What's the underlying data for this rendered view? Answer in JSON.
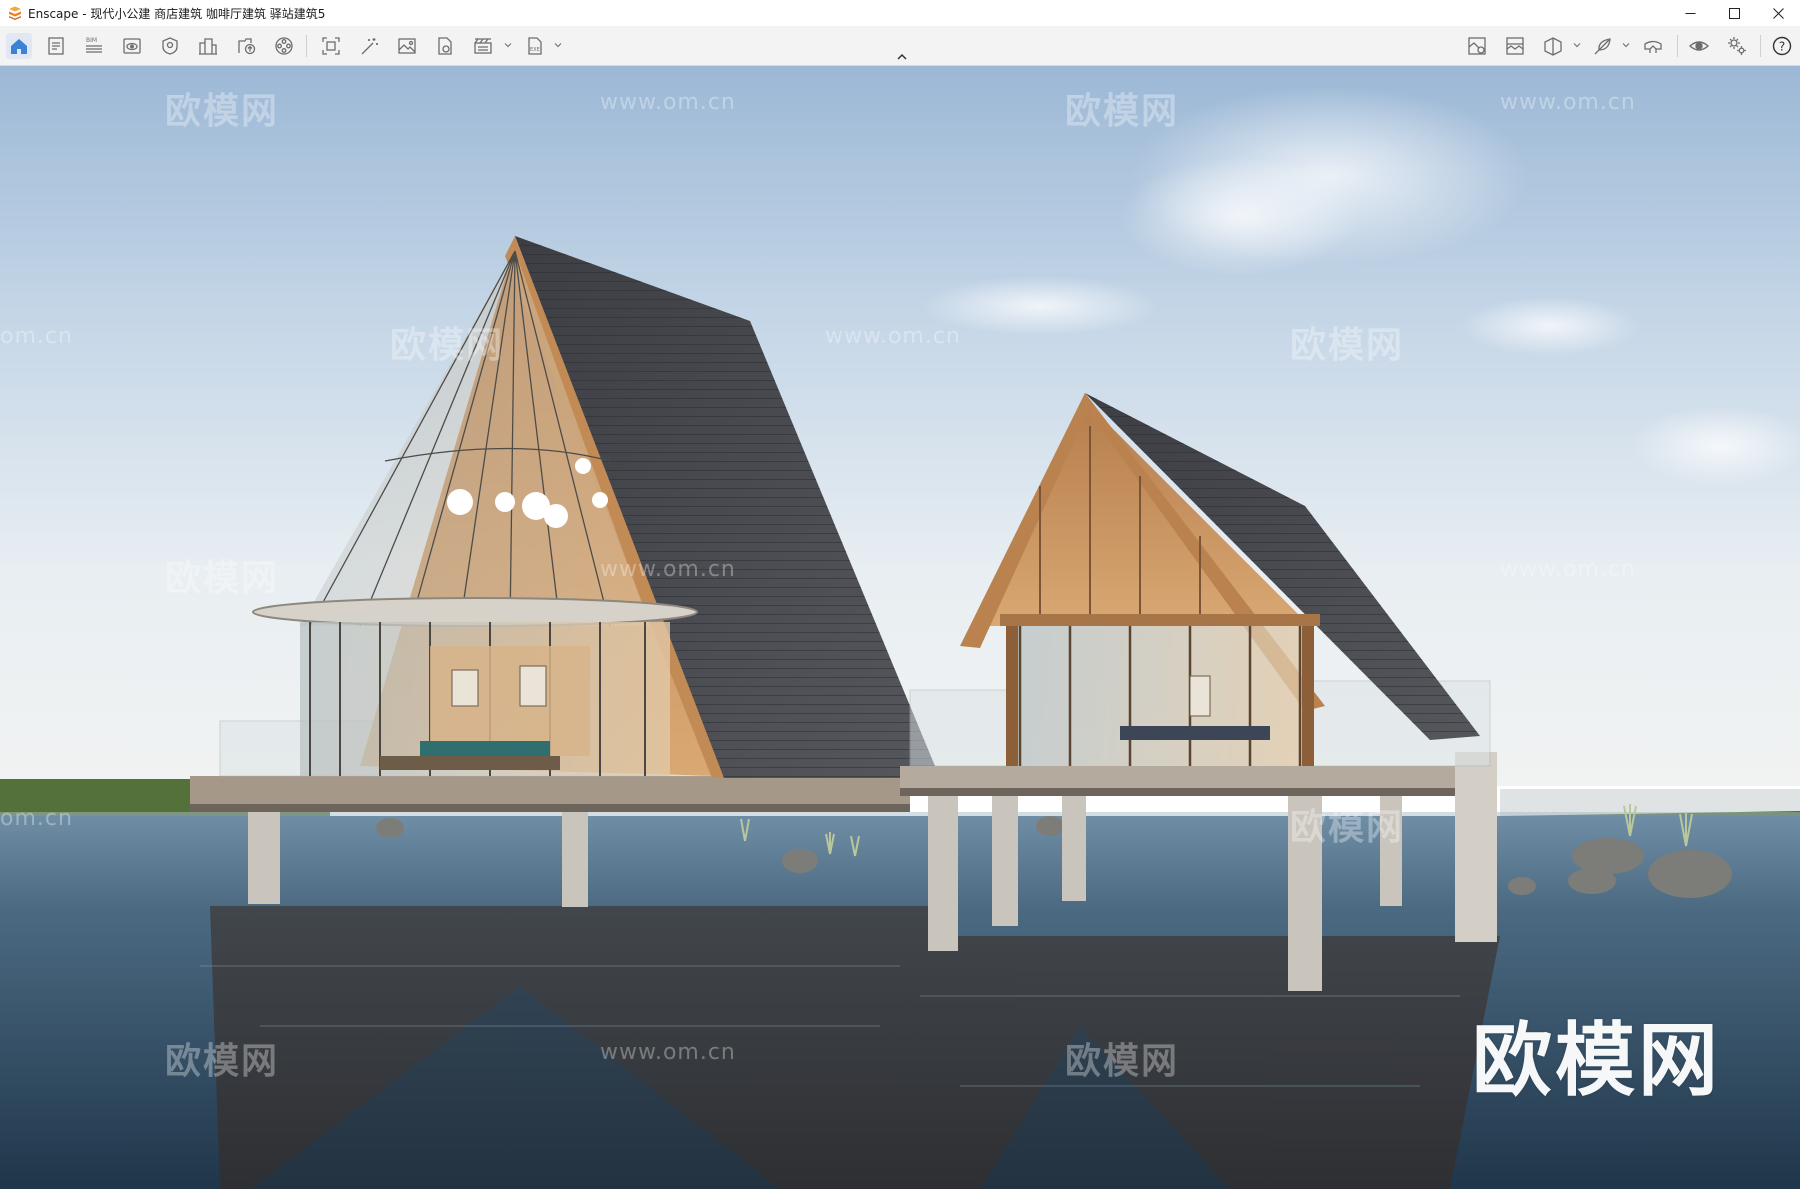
{
  "window": {
    "title": "Enscape - 现代小公建 商店建筑 咖啡厅建筑 驿站建筑5",
    "controls": [
      "minimize-icon",
      "maximize-icon",
      "close-icon"
    ]
  },
  "toolbar": {
    "left_tools": [
      "home-icon",
      "notes-icon",
      "bim-icon",
      "views-icon",
      "asset-library-icon",
      "model-icon",
      "upload-icon",
      "video-editor-icon",
      "screenshot-icon",
      "magic-wand-icon",
      "image-icon",
      "export-icon",
      "batch-render-icon",
      "exe-export-icon"
    ],
    "right_tools": [
      "material-editor-icon",
      "atmosphere-icon",
      "section-icon",
      "feather-icon",
      "vr-headset-icon",
      "visual-settings-icon",
      "general-settings-icon",
      "help-icon"
    ],
    "bim_label": "BIM",
    "exe_label": "EXE",
    "help_label": "?",
    "active_tool": "home-icon"
  },
  "viewport": {
    "scene": "rendered lakeside A-frame pavilions on stilts over water",
    "watermark_cn": "欧模网",
    "watermark_url": "www.om.cn",
    "watermark_url_cut": "om.cn",
    "brand_watermark": "欧模网"
  }
}
